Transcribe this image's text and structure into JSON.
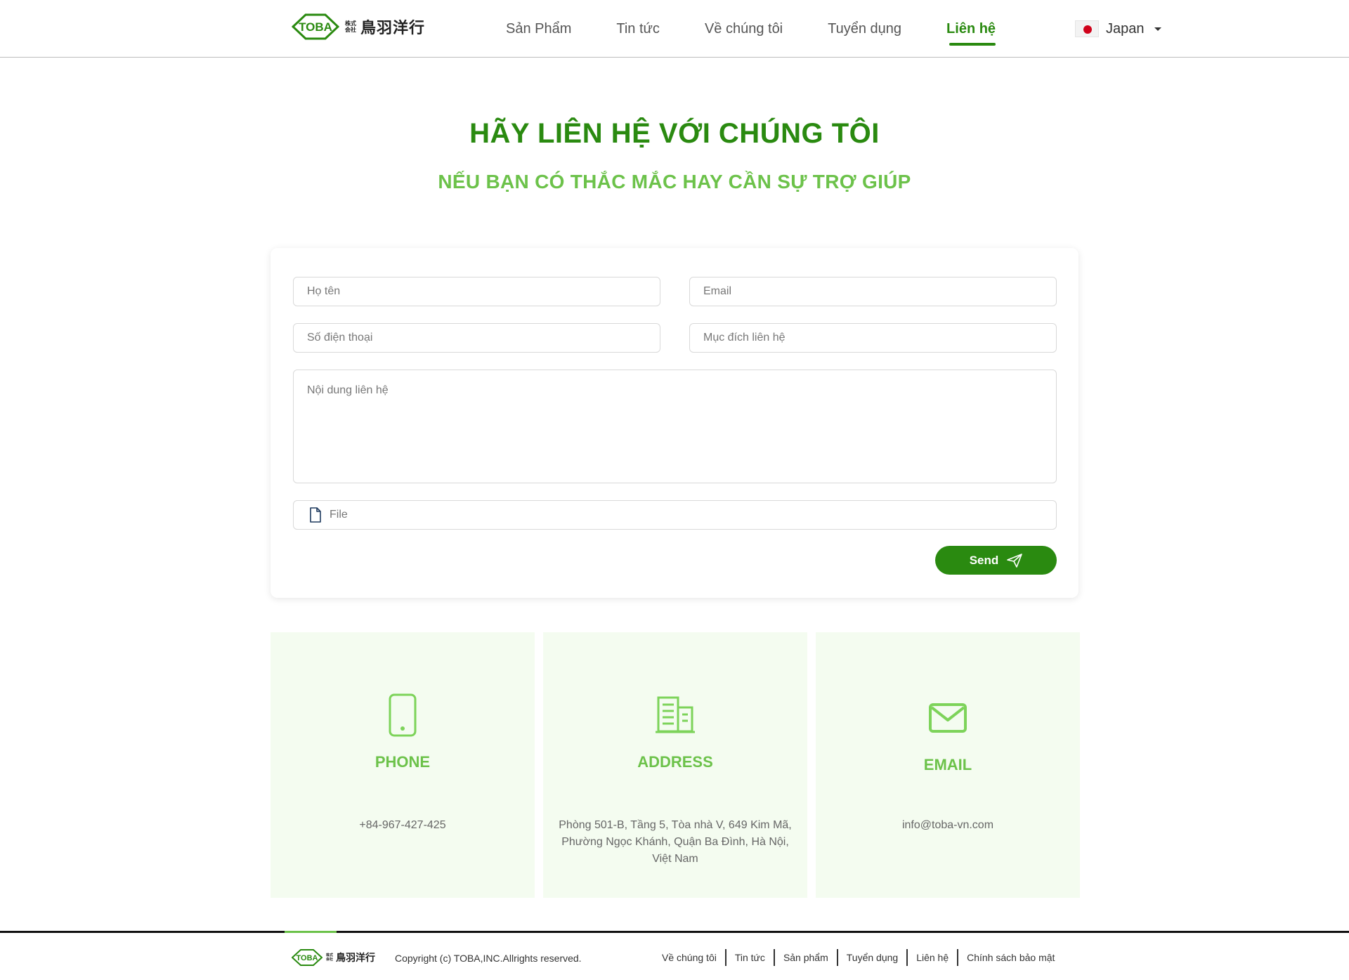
{
  "header": {
    "logo_mark": "TOBA",
    "logo_kabu_top": "株式",
    "logo_kabu_bottom": "会社",
    "logo_jp": "鳥羽洋行",
    "nav": [
      {
        "label": "Sản Phẩm"
      },
      {
        "label": "Tin tức"
      },
      {
        "label": "Về chúng tôi"
      },
      {
        "label": "Tuyển dụng"
      },
      {
        "label": "Liên hệ",
        "active": true
      }
    ],
    "language": "Japan"
  },
  "hero": {
    "title": "HÃY LIÊN HỆ VỚI CHÚNG TÔI",
    "subtitle": "NẾU BẠN CÓ THẮC MẮC HAY CẦN SỰ TRỢ GIÚP"
  },
  "form": {
    "name_placeholder": "Họ tên",
    "email_placeholder": "Email",
    "phone_placeholder": "Số điện thoại",
    "purpose_placeholder": "Mục đích liên hệ",
    "content_placeholder": "Nội dung liên hệ",
    "file_label": "File",
    "send_label": "Send"
  },
  "info": {
    "phone": {
      "title": "PHONE",
      "text": "+84-967-427-425",
      "icon": "phone-icon"
    },
    "address": {
      "title": "ADDRESS",
      "line1": "Phòng 501-B, Tầng 5, Tòa nhà V, 649 Kim Mã,",
      "line2": "Phường Ngọc Khánh, Quận Ba Đình, Hà Nội,",
      "line3": "Việt Nam",
      "icon": "building-icon"
    },
    "email": {
      "title": "EMAIL",
      "text": "info@toba-vn.com",
      "icon": "mail-icon"
    }
  },
  "footer": {
    "copyright": "Copyright (c) TOBA,INC.Allrights reserved.",
    "links": [
      "Về chúng tôi",
      "Tin tức",
      "Sản phẩm",
      "Tuyển dụng",
      "Liên hệ",
      "Chính sách bảo mật"
    ]
  },
  "colors": {
    "primary": "#2a8a10",
    "light_green": "#6cc24a",
    "info_bg": "#f4fcf0"
  }
}
